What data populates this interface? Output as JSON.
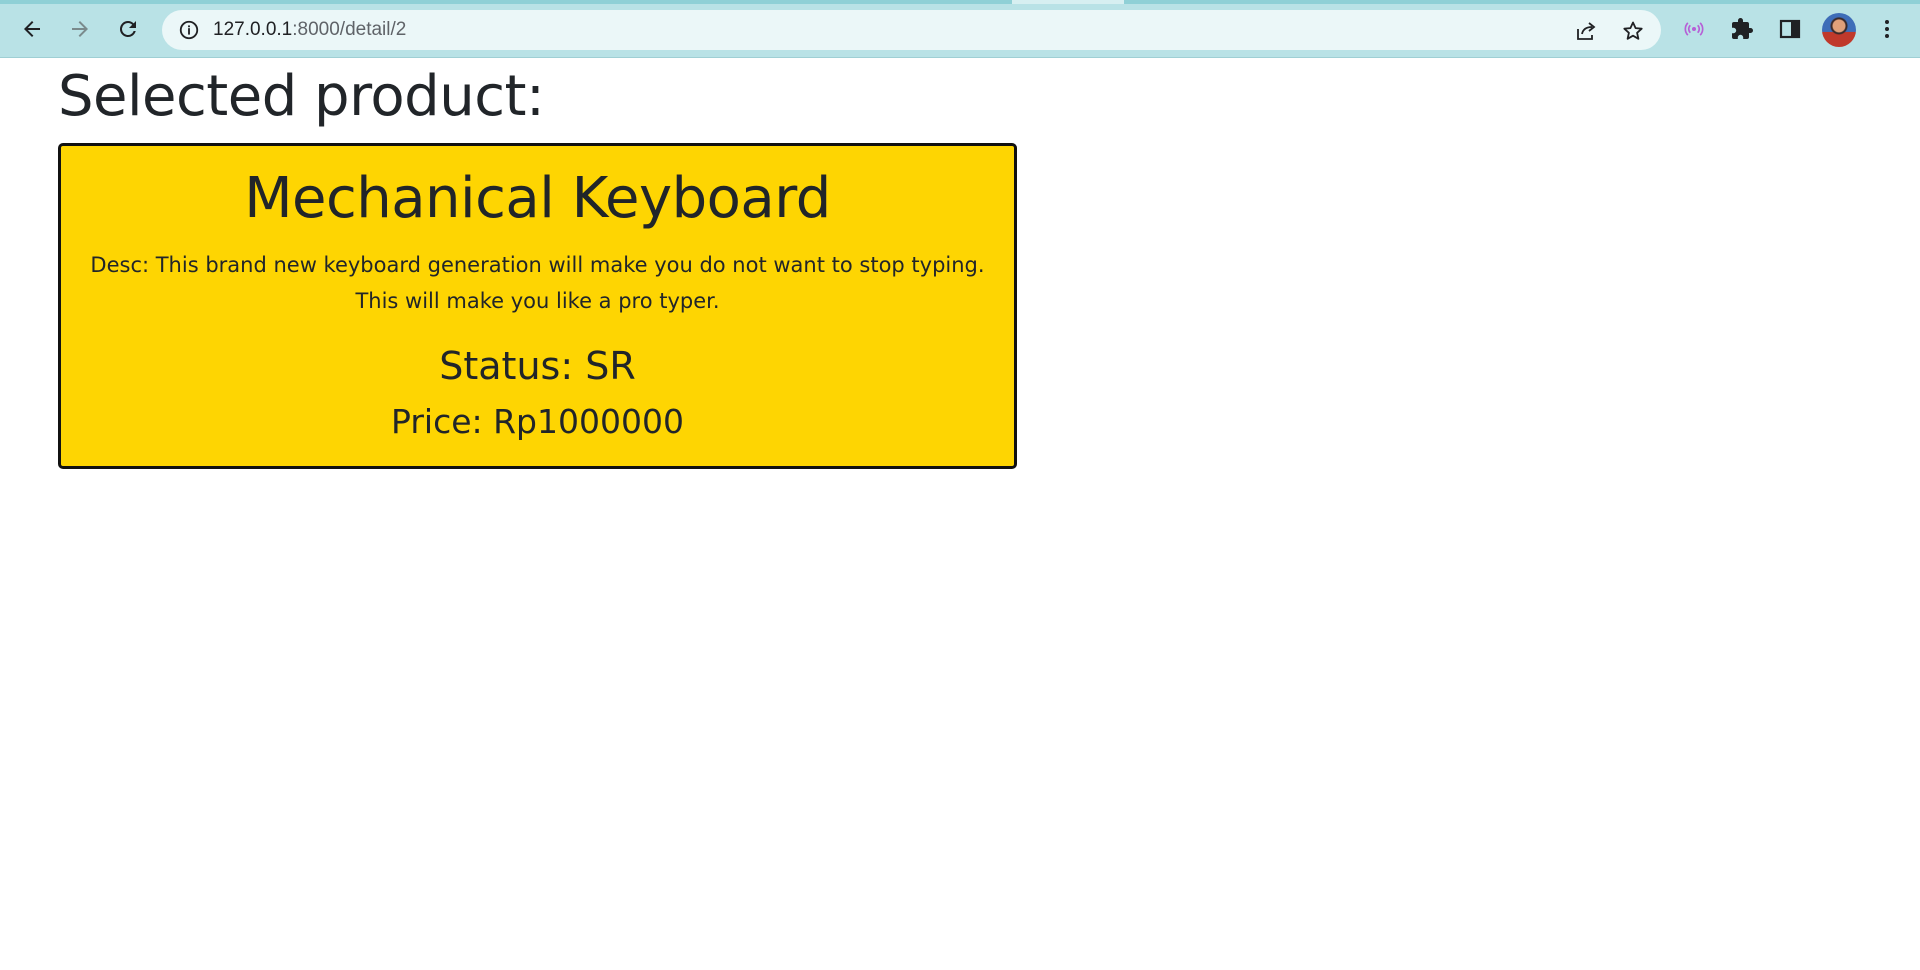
{
  "browser": {
    "url_host": "127.0.0.1",
    "url_path": ":8000/detail/2",
    "icons": {
      "back": "arrow-left-icon",
      "forward": "arrow-right-icon",
      "reload": "reload-icon",
      "site_info": "info-icon",
      "share": "share-icon",
      "bookmark": "star-icon",
      "extension": "broadcast-icon",
      "extensions": "puzzle-icon",
      "side_panel": "side-panel-icon",
      "menu": "kebab-menu-icon"
    },
    "colors": {
      "toolbar": "#b9e2e6",
      "omnibox": "#ebf7f8"
    }
  },
  "page": {
    "title": "Selected product:"
  },
  "product": {
    "name": "Mechanical Keyboard",
    "description": "Desc: This brand new keyboard generation will make you do not want to stop typing. This will make you like a pro typer.",
    "status": "Status: SR",
    "price": "Price: Rp1000000",
    "colors": {
      "card_background": "#fed502",
      "card_border": "#111111"
    }
  }
}
